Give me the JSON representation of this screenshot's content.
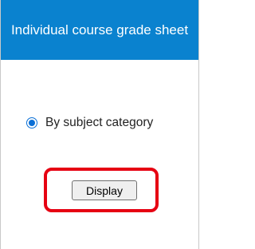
{
  "panel": {
    "title": "Individual course grade sheet"
  },
  "options": {
    "by_subject_category": {
      "label": "By subject category",
      "selected": true
    }
  },
  "actions": {
    "display_label": "Display"
  },
  "colors": {
    "header_bg": "#0a82cf",
    "highlight": "#e60012",
    "radio": "#0a6fd6"
  }
}
